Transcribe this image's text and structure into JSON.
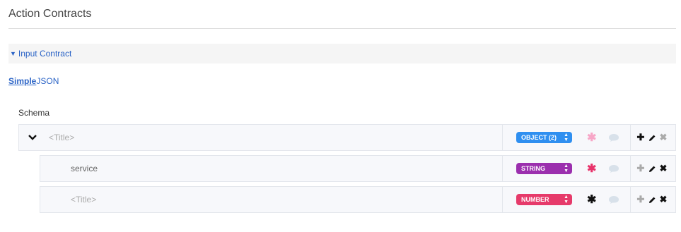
{
  "page": {
    "title": "Action Contracts"
  },
  "accordion": {
    "label": "Input Contract"
  },
  "mode_tabs": [
    {
      "label": "Simple",
      "active": true
    },
    {
      "label": "JSON",
      "active": false
    }
  ],
  "schema": {
    "label": "Schema",
    "rows": [
      {
        "name": "<Title>",
        "name_is_placeholder": true,
        "type": "OBJECT (2)",
        "type_color": "#2f8ff0",
        "required_color": "#f7a6c7",
        "add_color": "#111111",
        "delete_color": "#aaaaaa"
      },
      {
        "name": "service",
        "name_is_placeholder": false,
        "type": "STRING",
        "type_color": "#9b2fae",
        "required_color": "#e8336b",
        "add_color": "#aaaaaa",
        "delete_color": "#111111"
      },
      {
        "name": "<Title>",
        "name_is_placeholder": true,
        "type": "NUMBER",
        "type_color": "#e63a6a",
        "required_color": "#111111",
        "add_color": "#aaaaaa",
        "delete_color": "#111111"
      }
    ]
  },
  "colors": {
    "link": "#2a63c6",
    "comment_icon": "#d8e1ea"
  }
}
